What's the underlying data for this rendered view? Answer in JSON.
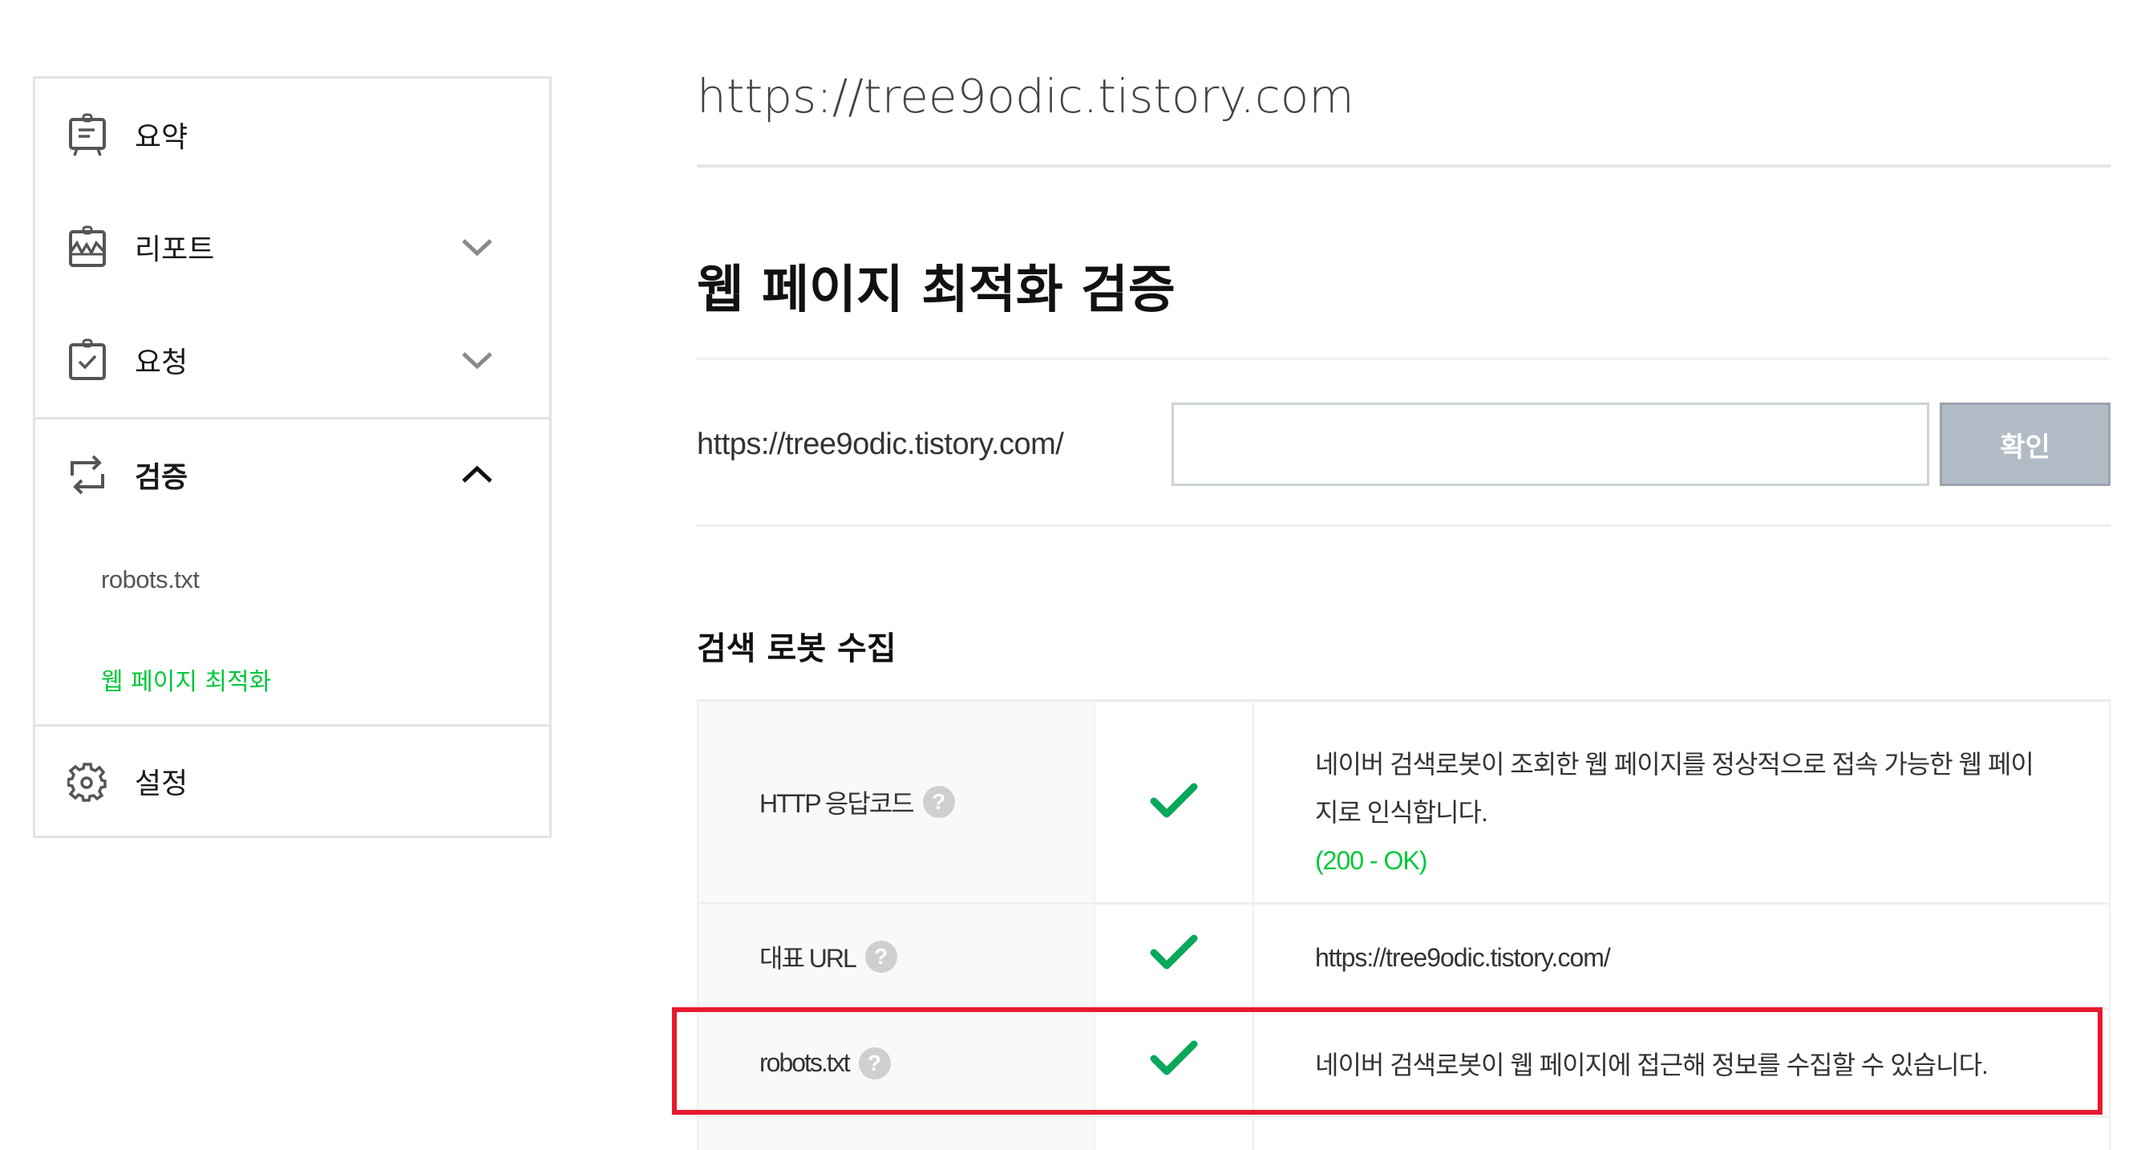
{
  "sidebar": {
    "items": [
      {
        "label": "요약",
        "icon": "easel-summary-icon",
        "expandable": false
      },
      {
        "label": "리포트",
        "icon": "chart-board-icon",
        "expandable": true,
        "expanded": false
      },
      {
        "label": "요청",
        "icon": "clipboard-check-icon",
        "expandable": true,
        "expanded": false
      },
      {
        "label": "검증",
        "icon": "repeat-arrows-icon",
        "expandable": true,
        "expanded": true,
        "children": [
          {
            "label": "robots.txt",
            "active": false
          },
          {
            "label": "웹 페이지 최적화",
            "active": true
          }
        ]
      },
      {
        "label": "설정",
        "icon": "gear-icon",
        "expandable": false
      }
    ]
  },
  "main": {
    "site_url": "https://tree9odic.tistory.com",
    "page_title": "웹 페이지 최적화 검증",
    "url_prefix": "https://tree9odic.tistory.com/",
    "url_input": {
      "value": "",
      "placeholder": ""
    },
    "confirm_label": "확인",
    "section_title": "검색 로봇 수집",
    "table": {
      "rows": [
        {
          "name": "HTTP 응답코드",
          "help": "?",
          "status": "pass",
          "description_lines": [
            "네이버 검색로봇이 조회한 웹 페이지를 정상적으로 접속 가능한 웹 페이",
            "지로 인식합니다."
          ],
          "status_text": "(200 - OK)"
        },
        {
          "name": "대표 URL",
          "help": "?",
          "status": "pass",
          "description": "https://tree9odic.tistory.com/"
        },
        {
          "name": "robots.txt",
          "help": "?",
          "status": "pass",
          "description": "네이버 검색로봇이 웹 페이지에 접근해 정보를 수집할 수 있습니다.",
          "highlighted": true
        }
      ]
    }
  },
  "colors": {
    "accent_green": "#00c73c",
    "check_green": "#0aa85a",
    "highlight_red": "#e8192c",
    "button_gray": "#b1bbc5"
  }
}
